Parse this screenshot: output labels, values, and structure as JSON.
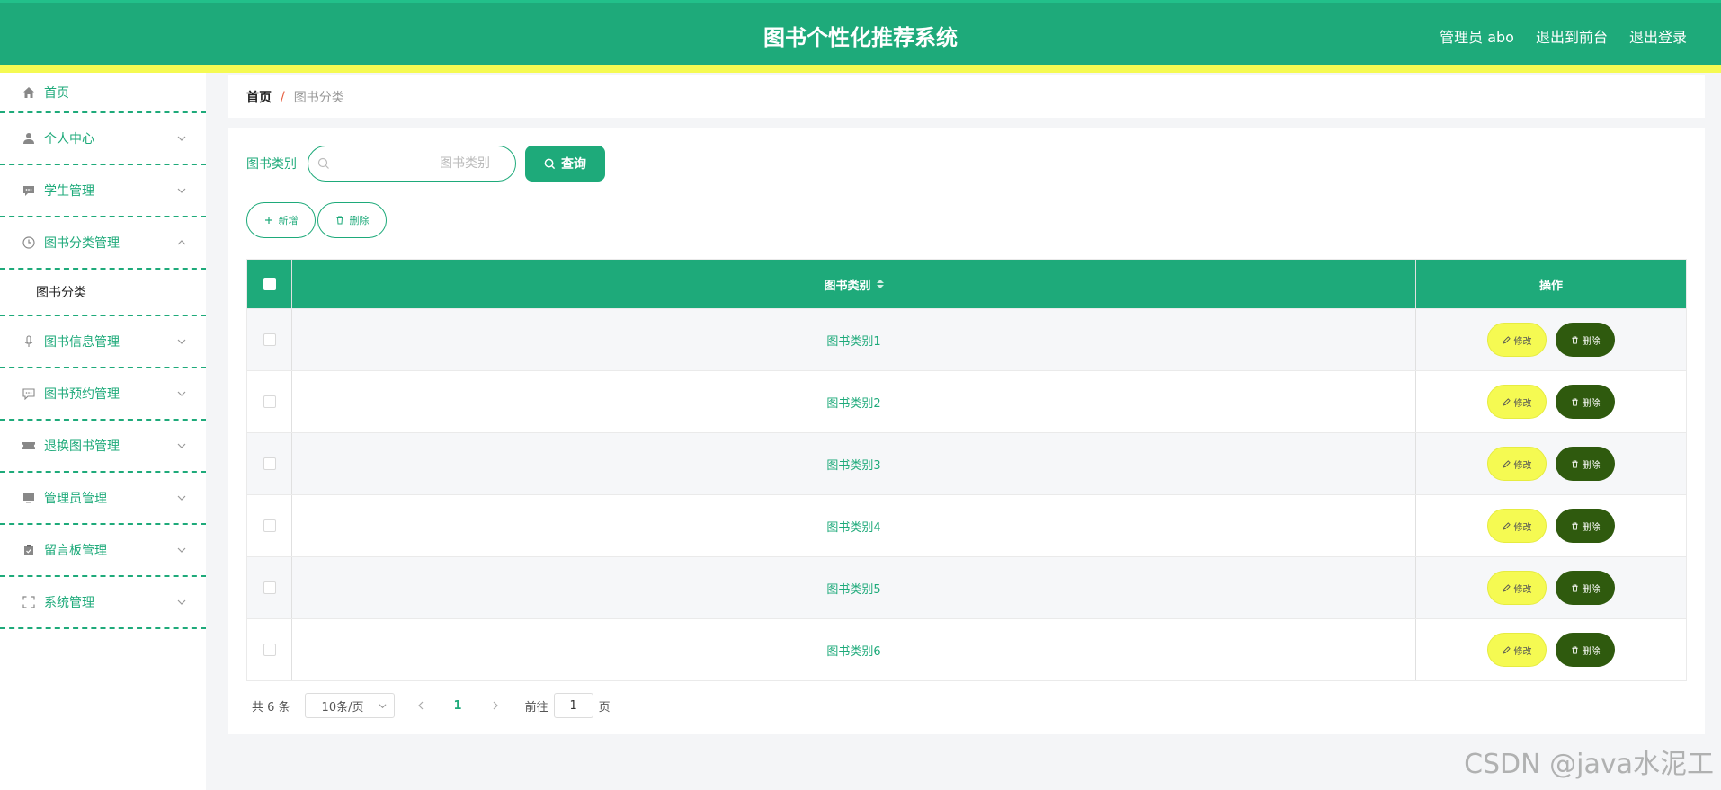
{
  "header": {
    "title": "图书个性化推荐系统",
    "user": "管理员 abo",
    "front": "退出到前台",
    "logout": "退出登录",
    "accent": "#1eaa7a",
    "highlight": "#f5fa52"
  },
  "sidebar": {
    "items": [
      {
        "label": "首页",
        "icon": "home-icon"
      },
      {
        "label": "个人中心",
        "icon": "user-icon"
      },
      {
        "label": "学生管理",
        "icon": "chat-icon"
      },
      {
        "label": "图书分类管理",
        "icon": "clock-icon",
        "expanded": true
      },
      {
        "label": "图书信息管理",
        "icon": "mic-icon"
      },
      {
        "label": "图书预约管理",
        "icon": "message-icon"
      },
      {
        "label": "退换图书管理",
        "icon": "ticket-icon"
      },
      {
        "label": "管理员管理",
        "icon": "monitor-icon"
      },
      {
        "label": "留言板管理",
        "icon": "clipboard-icon"
      },
      {
        "label": "系统管理",
        "icon": "fullscreen-icon"
      }
    ],
    "submenu": {
      "label": "图书分类"
    }
  },
  "breadcrumb": {
    "home": "首页",
    "separator": "/",
    "current": "图书分类"
  },
  "search": {
    "label": "图书类别",
    "placeholder": "图书类别",
    "button": "查询"
  },
  "actions": {
    "add": "新增",
    "delete": "删除"
  },
  "table": {
    "columns": {
      "name": "图书类别",
      "ops": "操作"
    },
    "rows": [
      "图书类别1",
      "图书类别2",
      "图书类别3",
      "图书类别4",
      "图书类别5",
      "图书类别6"
    ],
    "edit_label": "修改",
    "delete_label": "删除"
  },
  "pagination": {
    "total": "共 6 条",
    "page_size": "10条/页",
    "current_page": "1",
    "goto_prefix": "前往",
    "goto_value": "1",
    "goto_suffix": "页"
  },
  "watermark": "CSDN @java水泥工"
}
